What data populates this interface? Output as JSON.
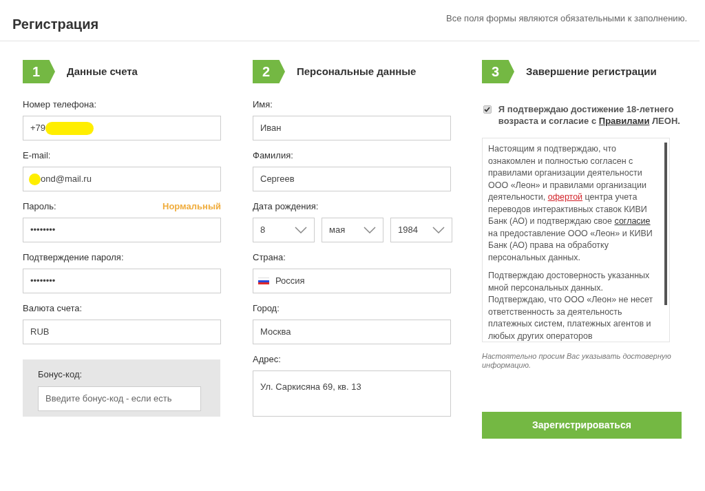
{
  "header": {
    "title": "Регистрация",
    "note": "Все поля формы являются обязательными к заполнению."
  },
  "columns": [
    {
      "step": "1",
      "title": "Данные счета",
      "fields": [
        {
          "kind": "input",
          "label": "Номер телефона:",
          "value": "+79",
          "masked_end": true
        },
        {
          "kind": "input",
          "label": "E-mail:",
          "value": "ond@mail.ru",
          "masked_start": true
        },
        {
          "kind": "input",
          "label": "Пароль:",
          "value": "••••••••",
          "strength": "Нормальный"
        },
        {
          "kind": "input",
          "label": "Подтверждение пароля:",
          "value": "••••••••"
        },
        {
          "kind": "input",
          "label": "Валюта счета:",
          "value": "RUB"
        }
      ],
      "bonus": {
        "label": "Бонус-код:",
        "placeholder": "Введите бонус-код - если есть"
      }
    },
    {
      "step": "2",
      "title": "Персональные данные",
      "fields": [
        {
          "kind": "input",
          "label": "Имя:",
          "value": "Иван"
        },
        {
          "kind": "input",
          "label": "Фамилия:",
          "value": "Сергеев"
        },
        {
          "kind": "selects",
          "label": "Дата рождения:",
          "values": [
            "8",
            "мая",
            "1984"
          ]
        },
        {
          "kind": "country",
          "label": "Страна:",
          "value": "Россия"
        },
        {
          "kind": "input",
          "label": "Город:",
          "value": "Москва"
        },
        {
          "kind": "textarea",
          "label": "Адрес:",
          "value": "Ул. Саркисяна 69, кв. 13"
        }
      ]
    },
    {
      "step": "3",
      "title": "Завершение регистрации",
      "agree": {
        "checked": true,
        "segments": [
          {
            "kind": "text",
            "text": "Я подтверждаю достижение 18-летнего возраста и согласие с "
          },
          {
            "kind": "link",
            "text": "Правилами"
          },
          {
            "kind": "text",
            "text": " ЛЕОН."
          }
        ]
      },
      "terms": [
        [
          {
            "kind": "text",
            "text": "Настоящим я подтверждаю, что ознакомлен и полностью согласен с правилами организации деятельности ООО «Леон» и правилами организации деятельности, "
          },
          {
            "kind": "red-link",
            "text": "офертой"
          },
          {
            "kind": "text",
            "text": " центра учета переводов интерактивных ставок КИВИ Банк (АО) и подтверждаю свое "
          },
          {
            "kind": "link",
            "text": "согласие"
          },
          {
            "kind": "text",
            "text": " на предоставление ООО «Леон» и КИВИ Банк (АО) права на обработку персональных данных."
          }
        ],
        [
          {
            "kind": "text",
            "text": "Подтверждаю достоверность указанных мной персональных данных. Подтверждаю, что ООО «Леон» не несет ответственность за деятельность платежных систем, платежных агентов и любых других операторов"
          }
        ]
      ],
      "note": "Настоятельно просим Вас указывать достоверную информацию.",
      "button": "Зарегистрироваться"
    }
  ]
}
